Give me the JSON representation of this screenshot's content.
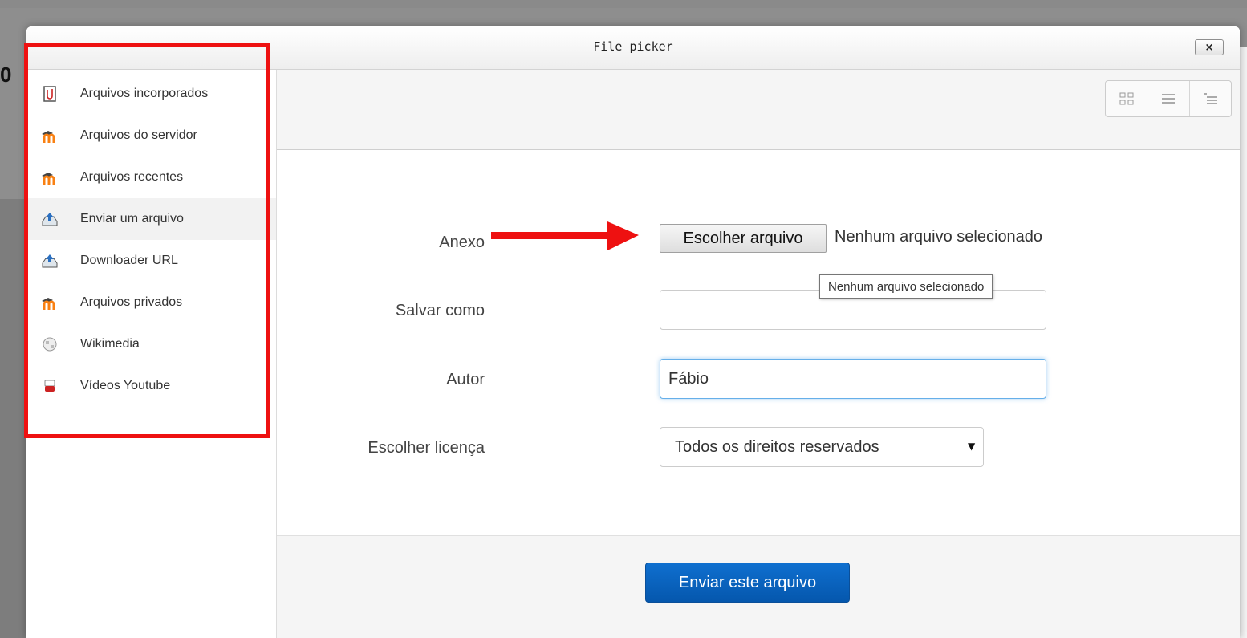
{
  "dialog": {
    "title": "File picker",
    "close_label": "×"
  },
  "sidebar": {
    "items": [
      {
        "label": "Arquivos incorporados",
        "icon": "embedded-files-icon"
      },
      {
        "label": "Arquivos do servidor",
        "icon": "moodle-icon"
      },
      {
        "label": "Arquivos recentes",
        "icon": "moodle-icon"
      },
      {
        "label": "Enviar um arquivo",
        "icon": "upload-icon",
        "active": true
      },
      {
        "label": "Downloader URL",
        "icon": "download-url-icon"
      },
      {
        "label": "Arquivos privados",
        "icon": "moodle-icon"
      },
      {
        "label": "Wikimedia",
        "icon": "wikimedia-icon"
      },
      {
        "label": "Vídeos Youtube",
        "icon": "youtube-icon"
      }
    ]
  },
  "toolbar": {
    "views": [
      "icons-view-icon",
      "list-view-icon",
      "tree-view-icon"
    ]
  },
  "form": {
    "attachment_label": "Anexo",
    "choose_file_label": "Escolher arquivo",
    "file_status": "Nenhum arquivo selecionado",
    "tooltip": "Nenhum arquivo selecionado",
    "save_as_label": "Salvar como",
    "save_as_value": "",
    "author_label": "Autor",
    "author_value": "Fábio",
    "license_label": "Escolher licença",
    "license_value": "Todos os direitos reservados",
    "submit_label": "Enviar este arquivo"
  },
  "colors": {
    "highlight": "#ee1111",
    "primary_button": "#0557ad",
    "focus": "#66afe9"
  }
}
